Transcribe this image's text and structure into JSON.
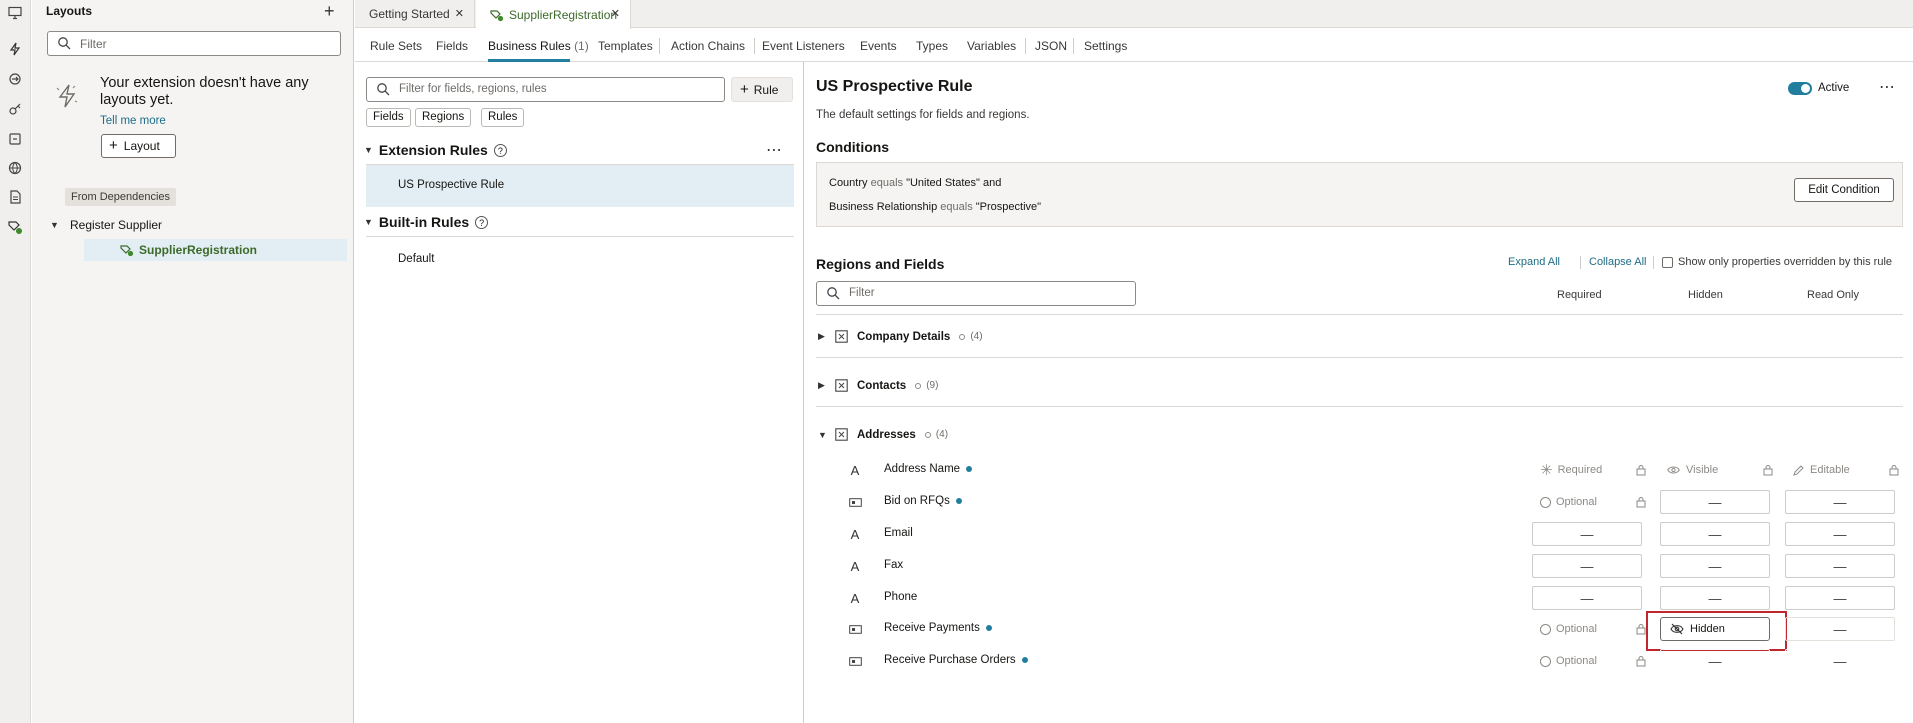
{
  "left_panel": {
    "title": "Layouts",
    "filter_placeholder": "Filter",
    "empty_message": "Your extension doesn't have any layouts yet.",
    "tell_me_more": "Tell me more",
    "layout_button": "Layout",
    "from_dependencies": "From Dependencies",
    "tree": {
      "parent": "Register Supplier",
      "child": "SupplierRegistration"
    }
  },
  "doc_tabs": [
    {
      "label": "Getting Started"
    },
    {
      "label": "SupplierRegistration"
    }
  ],
  "sub_tabs": [
    {
      "label": "Rule Sets"
    },
    {
      "label": "Fields"
    },
    {
      "label": "Business Rules",
      "count": "(1)"
    },
    {
      "label": "Templates"
    },
    {
      "label": "Action Chains"
    },
    {
      "label": "Event Listeners"
    },
    {
      "label": "Events"
    },
    {
      "label": "Types"
    },
    {
      "label": "Variables"
    },
    {
      "label": "JSON"
    },
    {
      "label": "Settings"
    }
  ],
  "middle": {
    "filter_placeholder": "Filter for fields, regions, rules",
    "add_rule": "Rule",
    "chips": [
      "Fields",
      "Regions",
      "Rules"
    ],
    "extension_rules": "Extension Rules",
    "ext_rule_item": "US Prospective Rule",
    "builtin_rules": "Built-in Rules",
    "builtin_item": "Default"
  },
  "right": {
    "title": "US Prospective Rule",
    "description": "The default settings for fields and regions.",
    "active_label": "Active",
    "conditions_title": "Conditions",
    "conditions": [
      {
        "field": "Country",
        "op": "equals",
        "value": "\"United States\"",
        "join": "and"
      },
      {
        "field": "Business Relationship",
        "op": "equals",
        "value": "\"Prospective\"",
        "join": ""
      }
    ],
    "edit_condition": "Edit Condition",
    "regions_title": "Regions and Fields",
    "expand_all": "Expand All",
    "collapse_all": "Collapse All",
    "show_only": "Show only properties overridden by this rule",
    "filter_placeholder": "Filter",
    "columns": [
      "Required",
      "Hidden",
      "Read Only"
    ],
    "regions": [
      {
        "name": "Company Details",
        "count": "(4)"
      },
      {
        "name": "Contacts",
        "count": "(9)"
      },
      {
        "name": "Addresses",
        "count": "(4)"
      }
    ],
    "fields": [
      {
        "name": "Address Name",
        "required": "Required",
        "hidden": "Visible",
        "readonly": "Editable"
      },
      {
        "name": "Bid on RFQs",
        "required": "Optional",
        "hidden": "—",
        "readonly": "—"
      },
      {
        "name": "Email",
        "required": "—",
        "hidden": "—",
        "readonly": "—"
      },
      {
        "name": "Fax",
        "required": "—",
        "hidden": "—",
        "readonly": "—"
      },
      {
        "name": "Phone",
        "required": "—",
        "hidden": "—",
        "readonly": "—"
      },
      {
        "name": "Receive Payments",
        "required": "Optional",
        "hidden": "Hidden",
        "readonly": "—"
      },
      {
        "name": "Receive Purchase Orders",
        "required": "Optional",
        "hidden": "—",
        "readonly": "—"
      }
    ]
  },
  "colors": {
    "accent": "#227e9e",
    "highlight": "#c0262d",
    "selected": "#e2eef3",
    "green": "#3d6a2a"
  }
}
